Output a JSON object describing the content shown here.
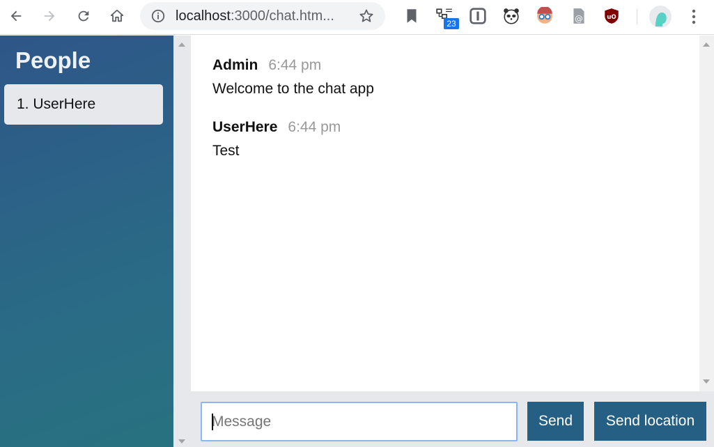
{
  "browser": {
    "url_host": "localhost",
    "url_rest": ":3000/chat.htm...",
    "extension_badge": "23"
  },
  "sidebar": {
    "title": "People",
    "users": [
      "1. UserHere"
    ]
  },
  "messages": [
    {
      "author": "Admin",
      "time": "6:44 pm",
      "text": "Welcome to the chat app"
    },
    {
      "author": "UserHere",
      "time": "6:44 pm",
      "text": "Test"
    }
  ],
  "composer": {
    "placeholder": "Message",
    "send_label": "Send",
    "send_location_label": "Send location"
  },
  "colors": {
    "sidebar_top": "#2e5688",
    "sidebar_bottom": "#287280",
    "button": "#265f84",
    "input_focus": "#89b4f5"
  }
}
